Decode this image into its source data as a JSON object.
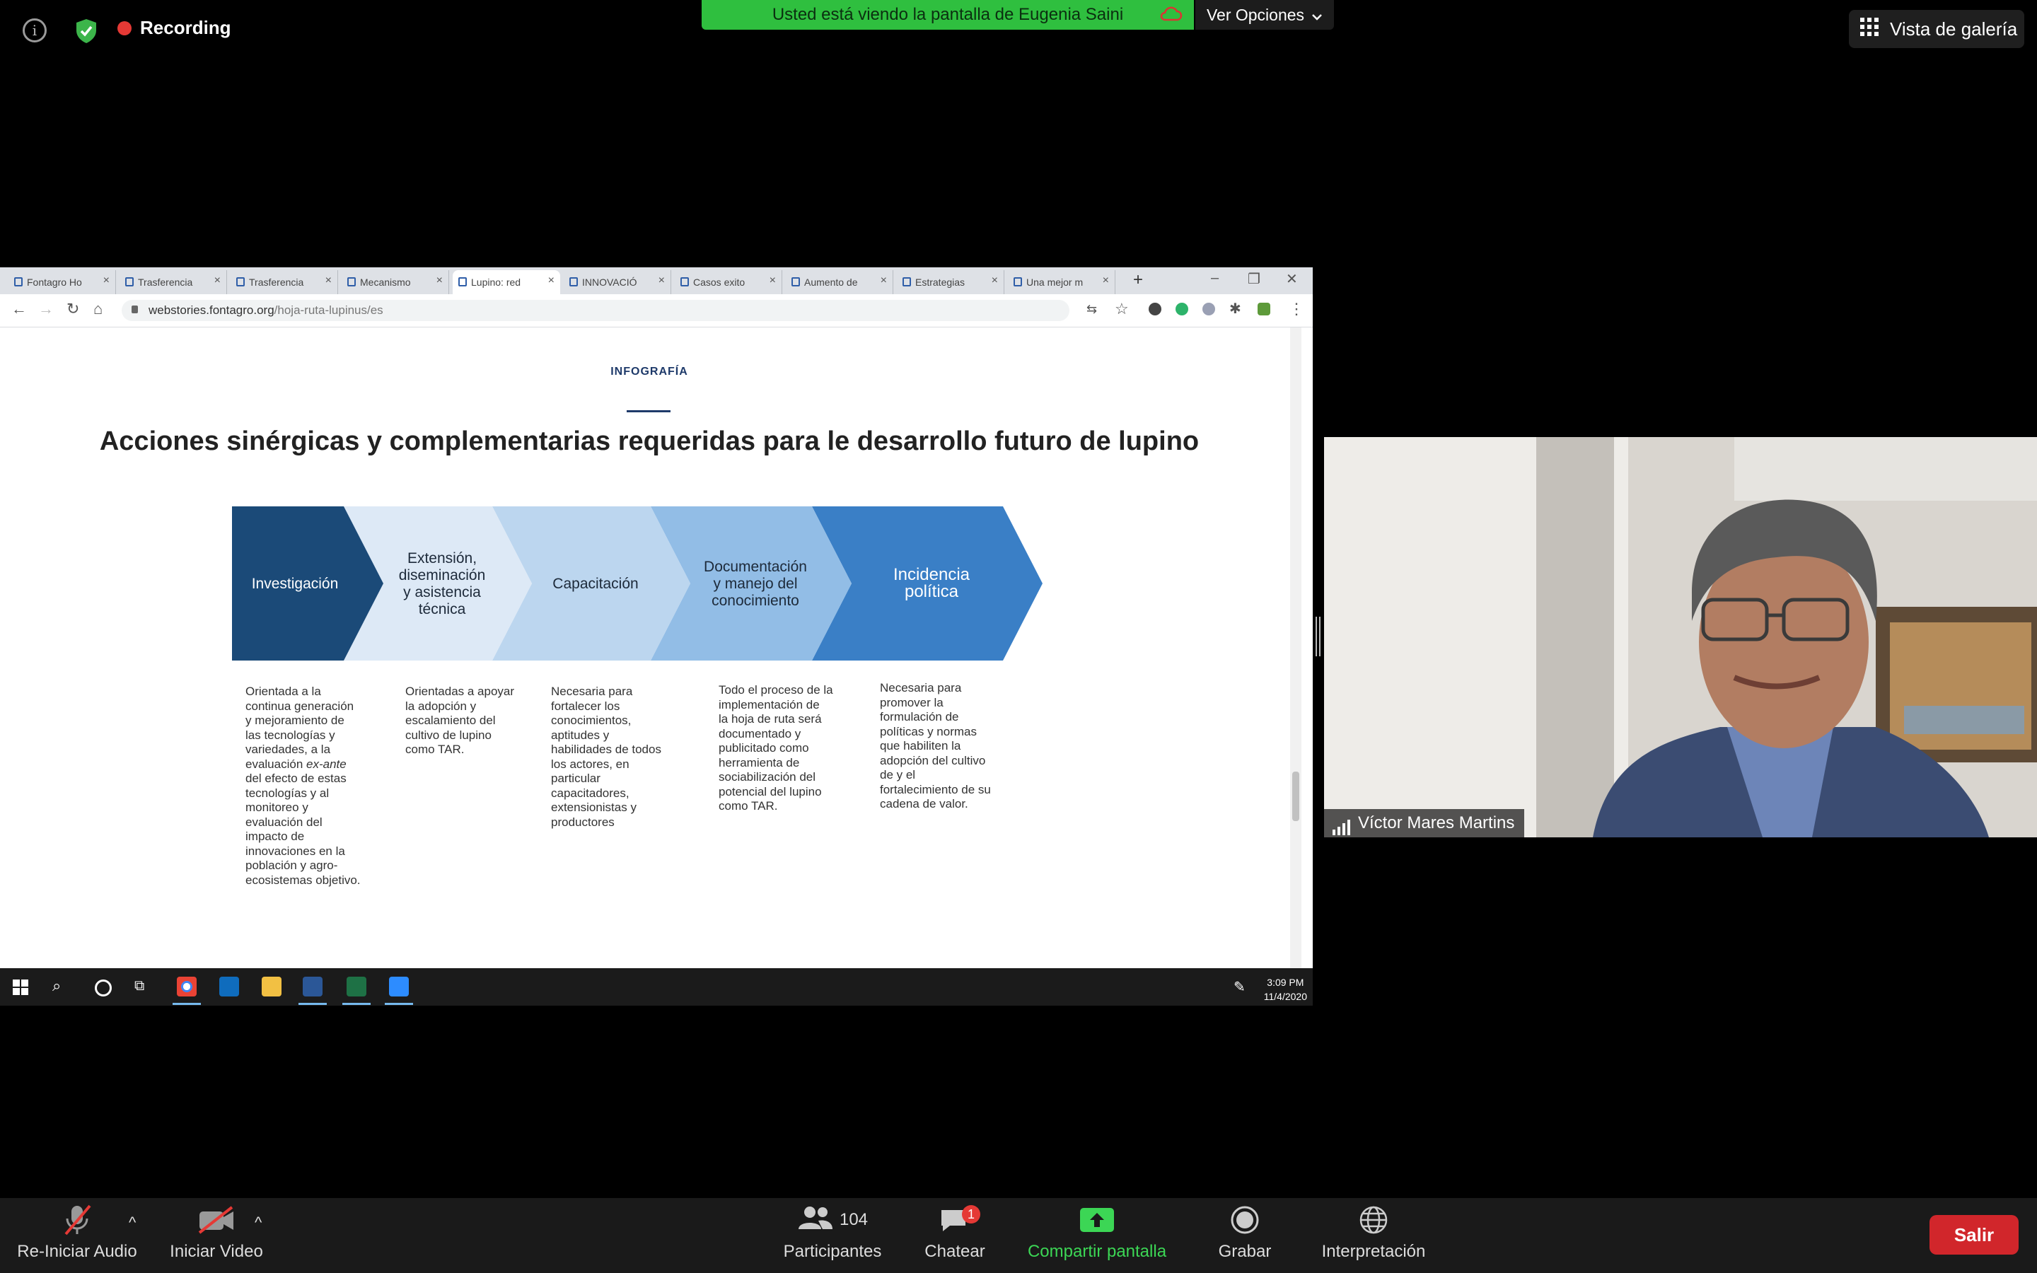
{
  "topbar": {
    "recording": "Recording",
    "banner": "Usted está viendo la pantalla de Eugenia Saini",
    "view_options": "Ver Opciones",
    "gallery_view": "Vista de galería"
  },
  "browser": {
    "tabs": [
      {
        "label": "Fontagro Ho",
        "active": false
      },
      {
        "label": "Trasferencia",
        "active": false
      },
      {
        "label": "Trasferencia",
        "active": false
      },
      {
        "label": "Mecanismo",
        "active": false
      },
      {
        "label": "Lupino: red",
        "active": true
      },
      {
        "label": "INNOVACIÓ",
        "active": false
      },
      {
        "label": "Casos exito",
        "active": false
      },
      {
        "label": "Aumento de",
        "active": false
      },
      {
        "label": "Estrategias",
        "active": false
      },
      {
        "label": "Una mejor m",
        "active": false
      }
    ],
    "url_domain": "webstories.fontagro.org",
    "url_path": "/hoja-ruta-lupinus/es"
  },
  "infographic": {
    "eyebrow": "INFOGRAFÍA",
    "heading": "Acciones sinérgicas y complementarias requeridas para le desarrollo futuro de lupino",
    "steps": [
      {
        "title": [
          "Investigación"
        ],
        "color": "#1b4a78",
        "text_color": "#ffffff",
        "desc": [
          "Orientada a la",
          "continua generación",
          "y mejoramiento de",
          "las tecnologías y",
          "variedades, a la",
          "evaluación ex-ante",
          "del efecto de estas",
          "tecnologías y al",
          "monitoreo y",
          "evaluación del",
          "impacto de",
          "innovaciones en la",
          "población y agro-",
          "ecosistemas objetivo."
        ]
      },
      {
        "title": [
          "Extensión,",
          "diseminación",
          "y asistencia",
          "técnica"
        ],
        "color": "#dde9f6",
        "text_color": "#1d2a3a",
        "desc": [
          "Orientadas a apoyar",
          "la adopción y",
          "escalamiento del",
          "cultivo de lupino",
          "como TAR."
        ]
      },
      {
        "title": [
          "Capacitación"
        ],
        "color": "#bcd6ef",
        "text_color": "#1d2a3a",
        "desc": [
          "Necesaria para",
          "fortalecer los",
          "conocimientos,",
          "aptitudes y",
          "habilidades de todos",
          "los actores, en",
          "particular",
          "capacitadores,",
          "extensionistas y",
          "productores"
        ]
      },
      {
        "title": [
          "Documentación",
          "y manejo del",
          "conocimiento"
        ],
        "color": "#92bde6",
        "text_color": "#1d2a3a",
        "desc": [
          "Todo el proceso de la",
          "implementación de",
          "la hoja de ruta será",
          "documentado y",
          "publicitado como",
          "herramienta de",
          "sociabilización del",
          "potencial del lupino",
          "como TAR."
        ]
      },
      {
        "title": [
          "Incidencia",
          "política"
        ],
        "color": "#3a7fc6",
        "text_color": "#ffffff",
        "desc": [
          "Necesaria para",
          "promover la",
          "formulación de",
          "políticas y normas",
          "que habiliten la",
          "adopción del cultivo",
          "de y el",
          "fortalecimiento de su",
          "cadena de valor."
        ]
      }
    ]
  },
  "taskbar": {
    "time": "3:09 PM",
    "date": "11/4/2020"
  },
  "participant": {
    "name": "Víctor Mares Martins"
  },
  "controls": {
    "audio": "Re-Iniciar Audio",
    "video": "Iniciar Video",
    "participants_count": "104",
    "participants": "Participantes",
    "chat": "Chatear",
    "chat_badge": "1",
    "share": "Compartir pantalla",
    "record": "Grabar",
    "interpretation": "Interpretación",
    "leave": "Salir"
  },
  "colors": {
    "share_green": "#3cd655",
    "banner_green": "#2fbf3f",
    "leave_red": "#d1262b"
  }
}
